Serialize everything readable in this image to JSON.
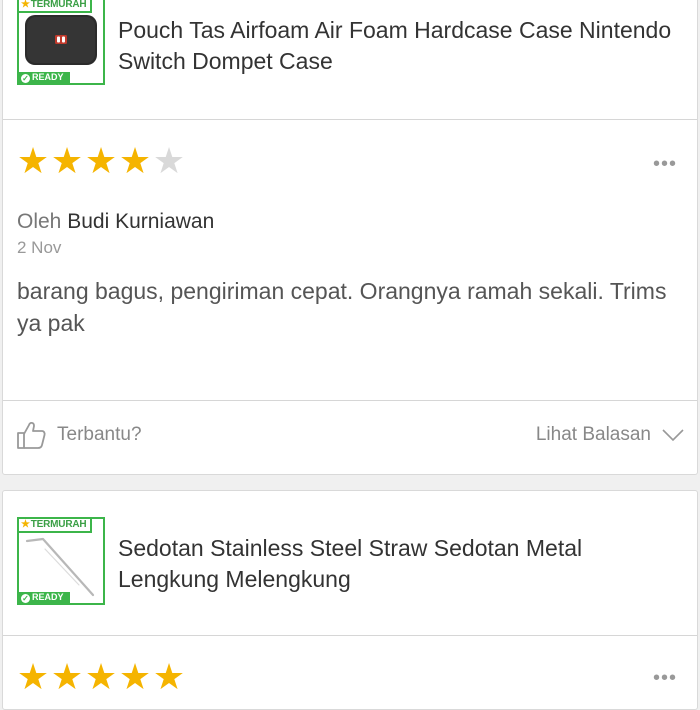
{
  "reviews": [
    {
      "product": {
        "badge_top": "TERMURAH",
        "badge_bottom": "READY",
        "title": "Pouch Tas Airfoam Air Foam Hardcase Case Nintendo Switch Dompet Case",
        "thumbnail_icon": "nintendo-switch-pouch-image"
      },
      "rating": 4,
      "rating_max": 5,
      "more_label": "•••",
      "author_prefix": "Oleh ",
      "author": "Budi Kurniawan",
      "date": "2 Nov",
      "text": "barang bagus, pengiriman cepat. Orangnya ramah sekali. Trims ya pak",
      "helpful_label": "Terbantu?",
      "replies_label": "Lihat Balasan"
    },
    {
      "product": {
        "badge_top": "TERMURAH",
        "badge_bottom": "READY",
        "title": "Sedotan Stainless Steel Straw Sedotan Metal Lengkung Melengkung",
        "thumbnail_icon": "metal-straw-image"
      },
      "rating": 5,
      "rating_max": 5,
      "more_label": "•••"
    }
  ],
  "colors": {
    "star_active": "#f5b400",
    "star_inactive": "#d9d9d9",
    "badge_green": "#3cb54a",
    "text_primary": "#333333",
    "text_muted": "#999999"
  }
}
